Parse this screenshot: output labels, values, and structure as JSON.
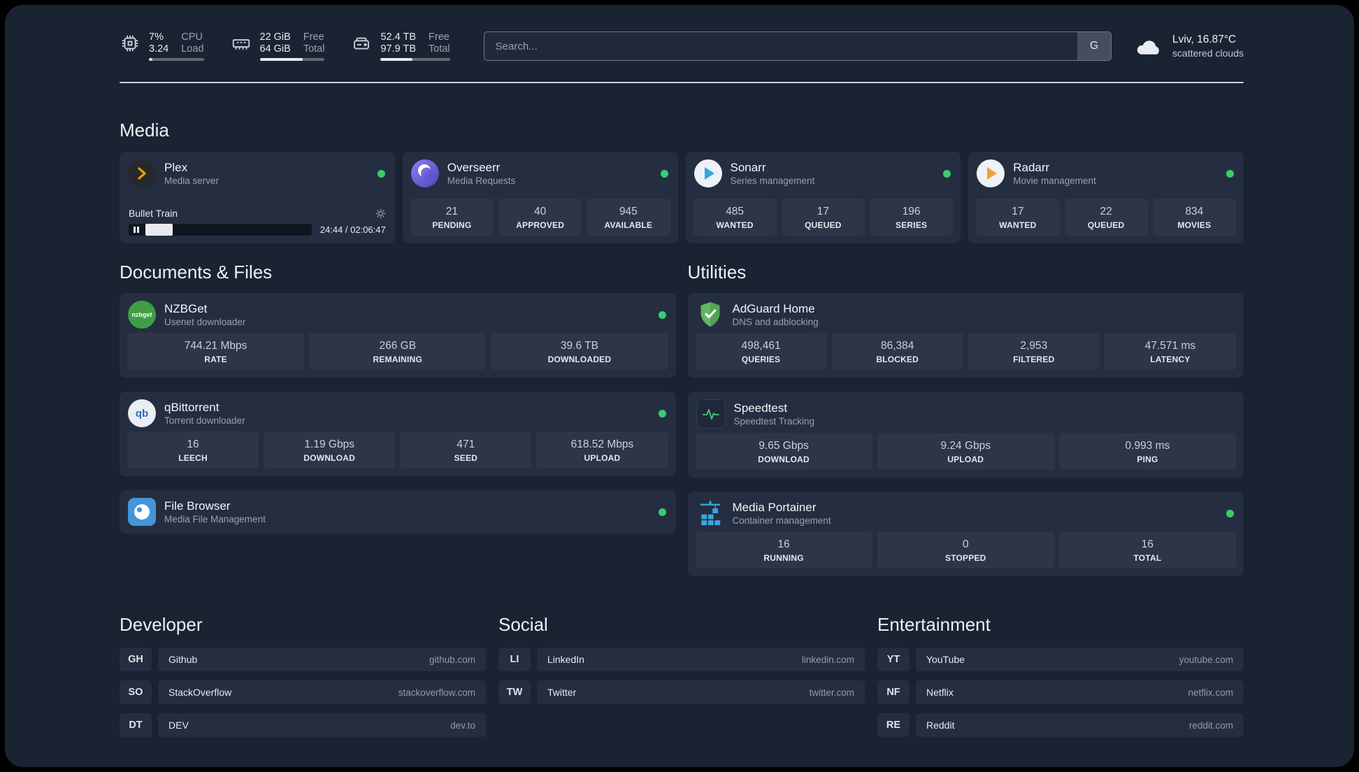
{
  "topbar": {
    "cpu": {
      "value1": "7%",
      "value2": "3.24",
      "label1": "CPU",
      "label2": "Load",
      "bar": 7
    },
    "memory": {
      "value1": "22 GiB",
      "value2": "64 GiB",
      "label1": "Free",
      "label2": "Total",
      "bar": 66
    },
    "disk": {
      "value1": "52.4 TB",
      "value2": "97.9 TB",
      "label1": "Free",
      "label2": "Total",
      "bar": 46
    },
    "search": {
      "placeholder": "Search...",
      "provider_label": "G"
    },
    "weather": {
      "location": "Lviv, 16.87°C",
      "condition": "scattered clouds"
    }
  },
  "colors": {
    "status_online": "#33cf72",
    "accent_green": "#44d07b",
    "background": "#1a2332",
    "card": "#242e40"
  },
  "sections": {
    "media": {
      "title": "Media",
      "services": [
        {
          "name": "Plex",
          "desc": "Media server",
          "online": true,
          "player": {
            "title": "Bullet Train",
            "time": "24:44 / 02:06:47",
            "progress": 15
          }
        },
        {
          "name": "Overseerr",
          "desc": "Media Requests",
          "online": true,
          "stats": [
            {
              "value": "21",
              "label": "PENDING"
            },
            {
              "value": "40",
              "label": "APPROVED"
            },
            {
              "value": "945",
              "label": "AVAILABLE"
            }
          ]
        },
        {
          "name": "Sonarr",
          "desc": "Series management",
          "online": true,
          "stats": [
            {
              "value": "485",
              "label": "WANTED"
            },
            {
              "value": "17",
              "label": "QUEUED"
            },
            {
              "value": "196",
              "label": "SERIES"
            }
          ]
        },
        {
          "name": "Radarr",
          "desc": "Movie management",
          "online": true,
          "stats": [
            {
              "value": "17",
              "label": "WANTED"
            },
            {
              "value": "22",
              "label": "QUEUED"
            },
            {
              "value": "834",
              "label": "MOVIES"
            }
          ]
        }
      ]
    },
    "documents": {
      "title": "Documents & Files",
      "services": [
        {
          "name": "NZBGet",
          "desc": "Usenet downloader",
          "online": true,
          "stats": [
            {
              "value": "744.21 Mbps",
              "label": "RATE"
            },
            {
              "value": "266 GB",
              "label": "REMAINING"
            },
            {
              "value": "39.6 TB",
              "label": "DOWNLOADED"
            }
          ]
        },
        {
          "name": "qBittorrent",
          "desc": "Torrent downloader",
          "online": true,
          "stats": [
            {
              "value": "16",
              "label": "LEECH"
            },
            {
              "value": "1.19 Gbps",
              "label": "DOWNLOAD"
            },
            {
              "value": "471",
              "label": "SEED"
            },
            {
              "value": "618.52 Mbps",
              "label": "UPLOAD"
            }
          ]
        },
        {
          "name": "File Browser",
          "desc": "Media File Management",
          "online": true
        }
      ]
    },
    "utilities": {
      "title": "Utilities",
      "services": [
        {
          "name": "AdGuard Home",
          "desc": "DNS and adblocking",
          "online": false,
          "stats": [
            {
              "value": "498,461",
              "label": "QUERIES"
            },
            {
              "value": "86,384",
              "label": "BLOCKED"
            },
            {
              "value": "2,953",
              "label": "FILTERED"
            },
            {
              "value": "47.571 ms",
              "label": "LATENCY"
            }
          ]
        },
        {
          "name": "Speedtest",
          "desc": "Speedtest Tracking",
          "online": false,
          "stats": [
            {
              "value": "9.65 Gbps",
              "label": "DOWNLOAD"
            },
            {
              "value": "9.24 Gbps",
              "label": "UPLOAD"
            },
            {
              "value": "0.993 ms",
              "label": "PING"
            }
          ]
        },
        {
          "name": "Media Portainer",
          "desc": "Container management",
          "online": true,
          "stats": [
            {
              "value": "16",
              "label": "RUNNING"
            },
            {
              "value": "0",
              "label": "STOPPED"
            },
            {
              "value": "16",
              "label": "TOTAL"
            }
          ]
        }
      ]
    }
  },
  "bookmarks": [
    {
      "title": "Developer",
      "items": [
        {
          "abbr": "GH",
          "name": "Github",
          "url": "github.com"
        },
        {
          "abbr": "SO",
          "name": "StackOverflow",
          "url": "stackoverflow.com"
        },
        {
          "abbr": "DT",
          "name": "DEV",
          "url": "dev.to"
        }
      ]
    },
    {
      "title": "Social",
      "items": [
        {
          "abbr": "LI",
          "name": "LinkedIn",
          "url": "linkedin.com"
        },
        {
          "abbr": "TW",
          "name": "Twitter",
          "url": "twitter.com"
        }
      ]
    },
    {
      "title": "Entertainment",
      "items": [
        {
          "abbr": "YT",
          "name": "YouTube",
          "url": "youtube.com"
        },
        {
          "abbr": "NF",
          "name": "Netflix",
          "url": "netflix.com"
        },
        {
          "abbr": "RE",
          "name": "Reddit",
          "url": "reddit.com"
        }
      ]
    }
  ]
}
